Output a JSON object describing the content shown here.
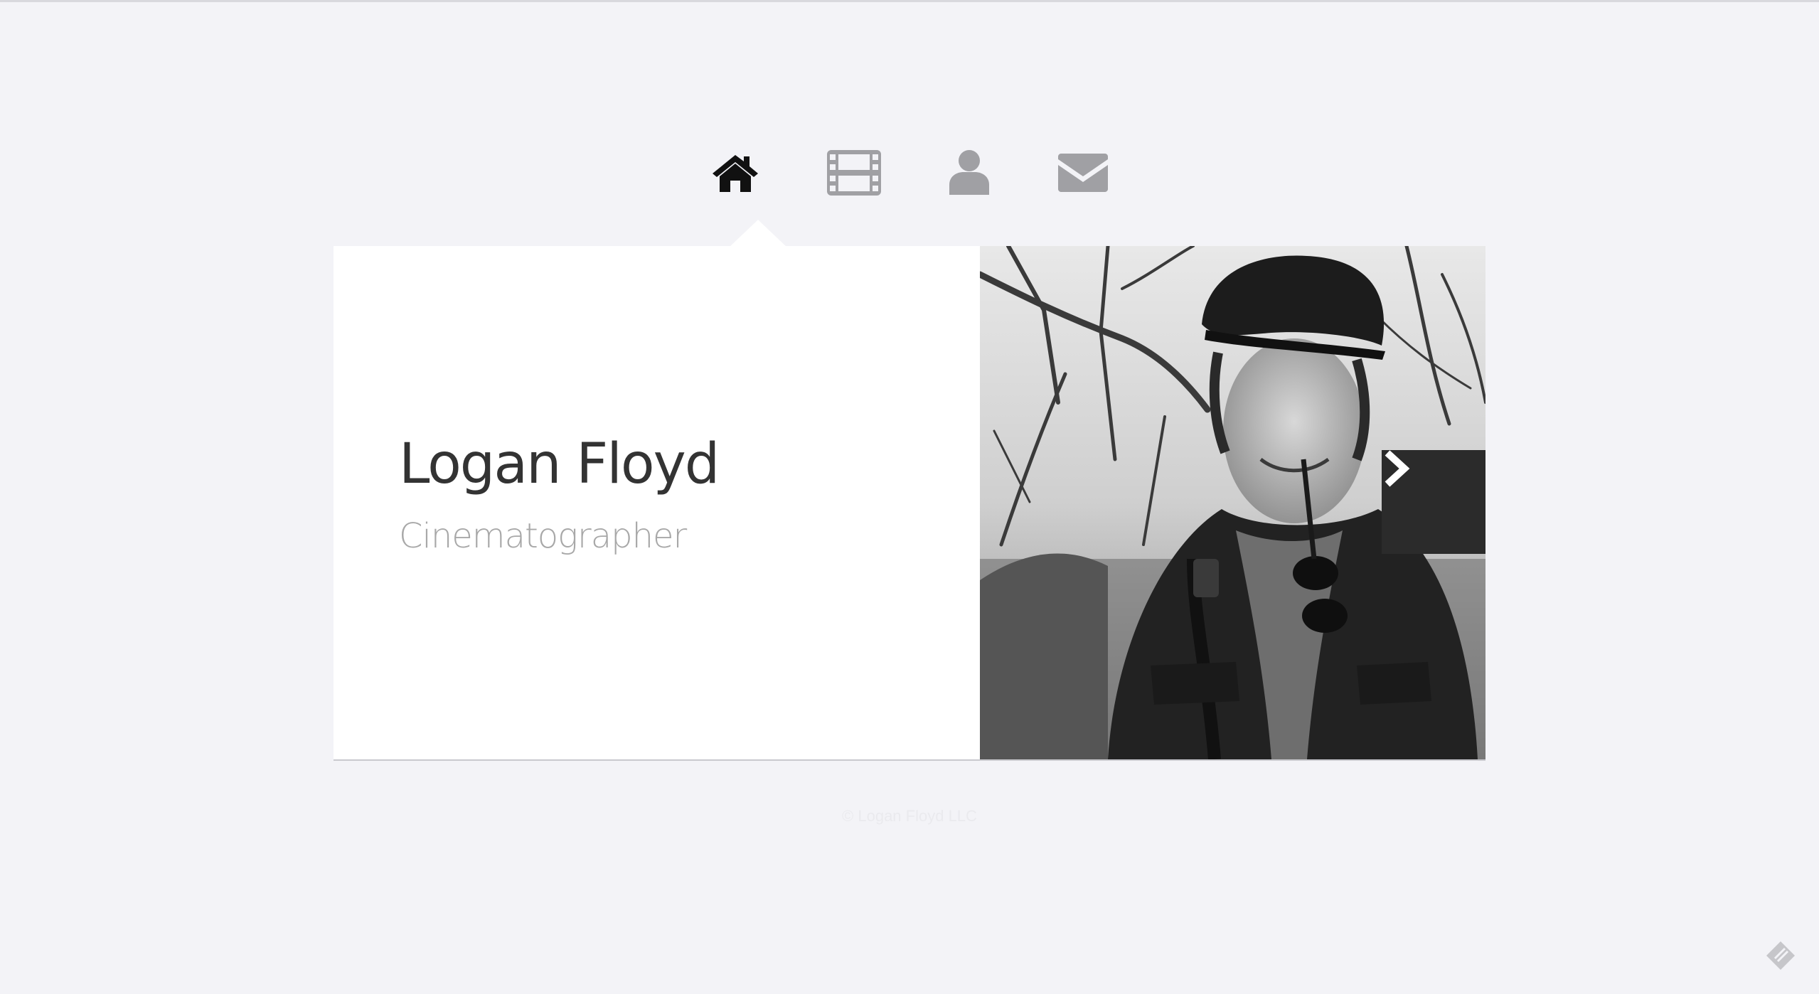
{
  "nav": {
    "items": [
      {
        "icon": "home-icon",
        "active": true,
        "color": "#111111"
      },
      {
        "icon": "film-icon",
        "active": false,
        "color": "#a0a0a4"
      },
      {
        "icon": "user-icon",
        "active": false,
        "color": "#a0a0a4"
      },
      {
        "icon": "envelope-icon",
        "active": false,
        "color": "#a0a0a4"
      }
    ]
  },
  "profile": {
    "name": "Logan Floyd",
    "title": "Cinematographer"
  },
  "slider": {
    "next_icon": "chevron-right-icon"
  },
  "footer": {
    "text": "© Logan Floyd LLC"
  },
  "colors": {
    "background": "#f3f3f7",
    "card": "#ffffff",
    "name": "#333333",
    "subtitle": "#a8a8a8",
    "button": "#2b2b2b"
  }
}
